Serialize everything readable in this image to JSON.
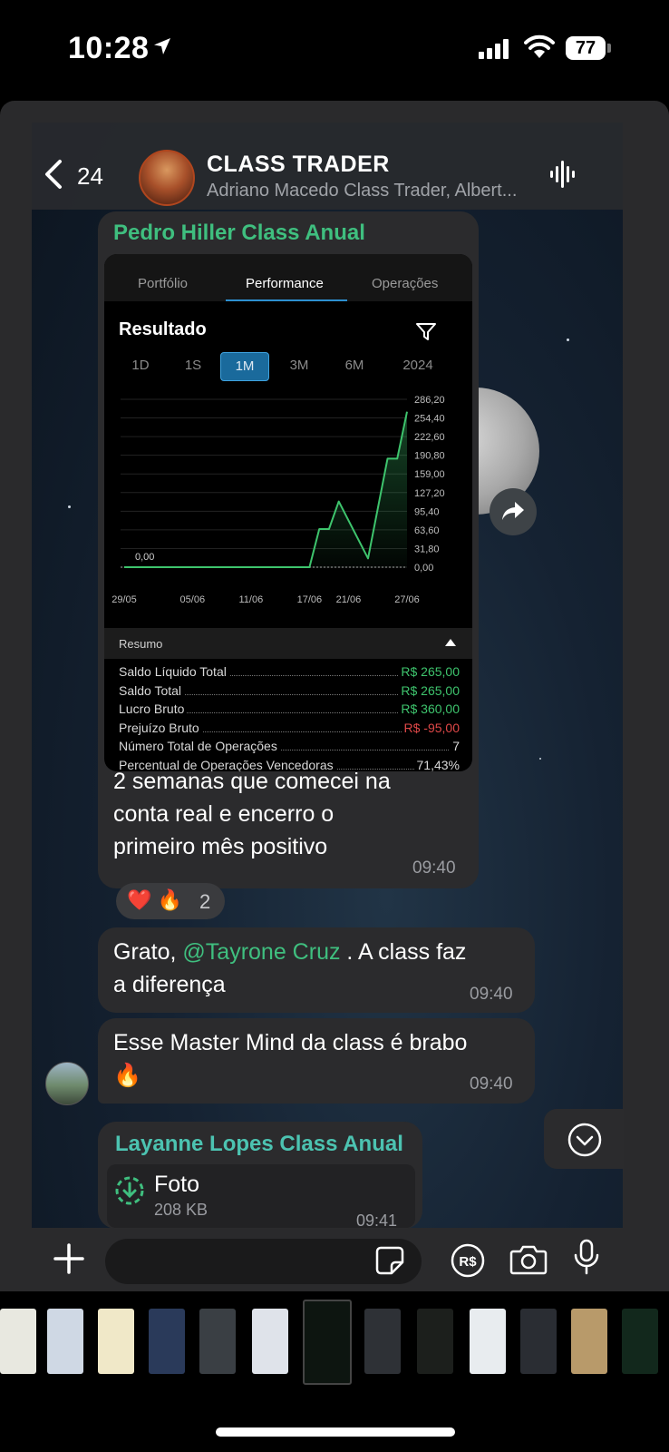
{
  "status_bar": {
    "time": "10:28",
    "battery": "77"
  },
  "header": {
    "back_count": "24",
    "group_name": "CLASS TRADER",
    "members": "Adriano Macedo Class Trader, Albert..."
  },
  "messages": [
    {
      "sender": "Pedro Hiller Class Anual",
      "text_lines": [
        "2 semanas que comecei na",
        "conta real e encerro o",
        "primeiro mês positivo"
      ],
      "time": "09:40",
      "reactions": {
        "emojis": "❤️ 🔥",
        "count": "2"
      }
    },
    {
      "text_prefix": "Grato, ",
      "mention": "@Tayrone Cruz",
      "text_suffix": " . A class faz",
      "text_line2": "a diferença",
      "time": "09:40"
    },
    {
      "text_line1": "Esse Master Mind da class é brabo",
      "emoji": "🔥",
      "time": "09:40"
    },
    {
      "sender": "Layanne Lopes Class Anual",
      "file_type": "Foto",
      "file_size": "208 KB",
      "time": "09:41"
    }
  ],
  "screenshot": {
    "tabs": [
      "Portfólio",
      "Performance",
      "Operações"
    ],
    "active_tab": "Performance",
    "section_title": "Resultado",
    "periods": [
      "1D",
      "1S",
      "1M",
      "3M",
      "6M",
      "2024"
    ],
    "active_period": "1M",
    "resumo_label": "Resumo",
    "stats": [
      {
        "label": "Saldo Líquido Total",
        "value": "R$ 265,00",
        "color": "#3ec46d"
      },
      {
        "label": "Saldo Total",
        "value": "R$ 265,00",
        "color": "#3ec46d"
      },
      {
        "label": "Lucro Bruto",
        "value": "R$ 360,00",
        "color": "#3ec46d"
      },
      {
        "label": "Prejuízo Bruto",
        "value": "R$ -95,00",
        "color": "#e04848"
      },
      {
        "label": "Número Total de Operações",
        "value": "7",
        "color": "#d8d8d8"
      },
      {
        "label": "Percentual de Operações Vencedoras",
        "value": "71,43%",
        "color": "#d8d8d8"
      }
    ]
  },
  "chart_data": {
    "type": "line",
    "x": [
      "29/05",
      "05/06",
      "11/06",
      "17/06",
      "21/06",
      "27/06"
    ],
    "y_ticks": [
      "286,20",
      "254,40",
      "222,60",
      "190,80",
      "159,00",
      "127,20",
      "95,40",
      "63,60",
      "31,80",
      "0,00"
    ],
    "ylim": [
      0,
      286.2
    ],
    "start_label": "0,00",
    "series": [
      {
        "points": [
          [
            "29/05",
            0
          ],
          [
            "17/06",
            0
          ],
          [
            "18/06",
            65
          ],
          [
            "19/06",
            65
          ],
          [
            "20/06",
            112
          ],
          [
            "23/06",
            15
          ],
          [
            "25/06",
            185
          ],
          [
            "26/06",
            185
          ],
          [
            "27/06",
            265
          ]
        ]
      }
    ],
    "line_color": "#3ec46d"
  },
  "composer": {
    "placeholder": ""
  },
  "colors": {
    "sender_green": "#3fbf7f",
    "sender_teal": "#4cc3b1",
    "mention": "#3fbf7f",
    "accent_blue": "#1a6a9c"
  }
}
